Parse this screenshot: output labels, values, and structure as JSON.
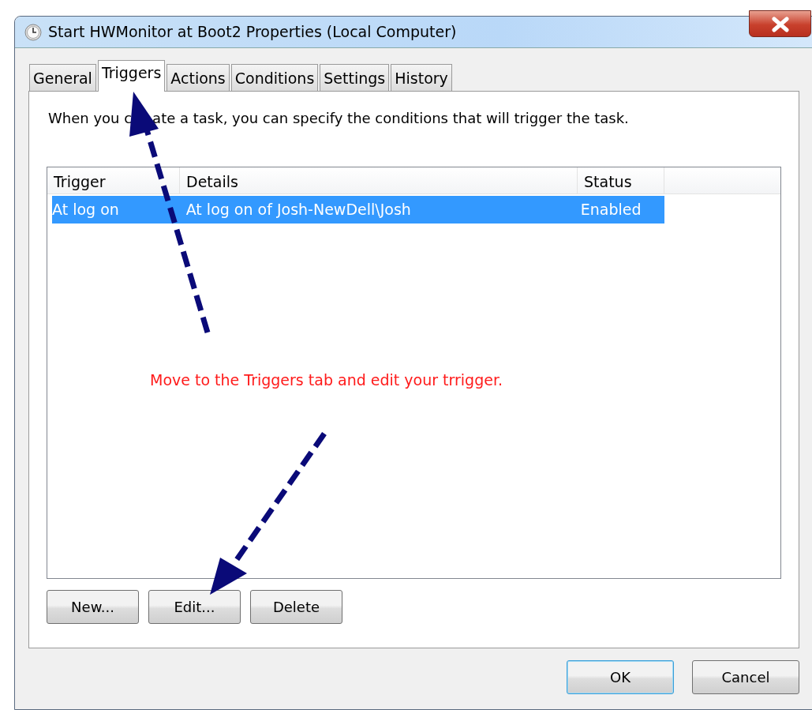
{
  "window": {
    "title": "Start HWMonitor at Boot2 Properties (Local Computer)"
  },
  "tabs": [
    {
      "label": "General",
      "selected": false
    },
    {
      "label": "Triggers",
      "selected": true
    },
    {
      "label": "Actions",
      "selected": false
    },
    {
      "label": "Conditions",
      "selected": false
    },
    {
      "label": "Settings",
      "selected": false
    },
    {
      "label": "History",
      "selected": false
    }
  ],
  "description": [
    "When you c",
    "ate a task, you can specify the conditions that will trigger the task."
  ],
  "table": {
    "columns": [
      "Trigger",
      "Details",
      "Status"
    ],
    "rows": [
      {
        "cells": [
          "At log on",
          "At log on of Josh-NewDell\\Josh",
          "Enabled"
        ],
        "selected": true
      }
    ]
  },
  "annotation": "Move to the Triggers tab and edit your trrigger.",
  "list_buttons": [
    "New...",
    "Edit...",
    "Delete"
  ],
  "dialog_buttons": [
    {
      "label": "OK",
      "default": true
    },
    {
      "label": "Cancel",
      "default": false
    }
  ]
}
